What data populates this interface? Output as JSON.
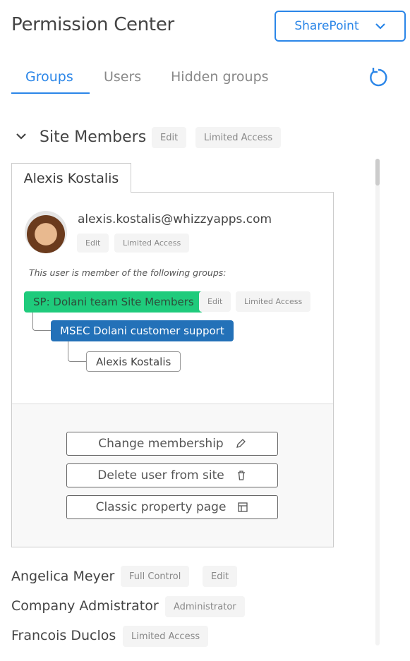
{
  "header": {
    "title": "Permission Center",
    "source_select": "SharePoint"
  },
  "tabs": [
    {
      "label": "Groups",
      "active": true
    },
    {
      "label": "Users"
    },
    {
      "label": "Hidden groups"
    }
  ],
  "section": {
    "title": "Site Members",
    "tags": [
      "Edit",
      "Limited Access"
    ]
  },
  "user": {
    "name": "Alexis Kostalis",
    "email": "alexis.kostalis@whizzyapps.com",
    "tags": [
      "Edit",
      "Limited Access"
    ],
    "membership_note": "This user is member of the following groups:",
    "groups": [
      {
        "name": "SP: Dolani team Site Members",
        "tags": [
          "Edit",
          "Limited Access"
        ],
        "color": "#1fcb7c"
      },
      {
        "name": "MSEC Dolani customer support",
        "color": "#2371b8"
      },
      {
        "name": "Alexis Kostalis"
      }
    ],
    "actions": [
      "Change membership",
      "Delete user from site",
      "Classic property page"
    ]
  },
  "members": [
    {
      "name": "Angelica Meyer",
      "tags": [
        "Full Control",
        "Edit"
      ]
    },
    {
      "name": "Company Admistrator",
      "tags": [
        "Administrator"
      ]
    },
    {
      "name": "Francois Duclos",
      "tags": [
        "Limited Access"
      ]
    }
  ]
}
